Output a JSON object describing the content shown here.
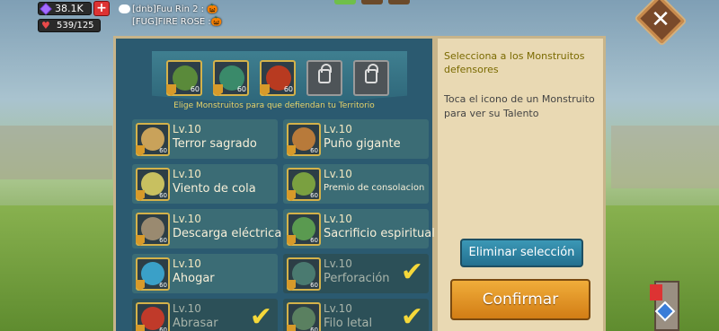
{
  "hud": {
    "gems": "38.1K",
    "plus": "+",
    "health": "539/125"
  },
  "chat": {
    "line1": "[dnb]Fuu Rin 2 :",
    "line2": "[FUG]FIRE  ROSE :"
  },
  "close_label": "✕",
  "defense_slots": [
    {
      "state": "filled",
      "level": "60"
    },
    {
      "state": "filled",
      "level": "60"
    },
    {
      "state": "filled",
      "level": "60"
    },
    {
      "state": "locked"
    },
    {
      "state": "locked"
    }
  ],
  "subtitle": "Elige Monstruitos para que defiendan tu Territorio",
  "familiars": [
    {
      "level": "Lv.10",
      "name": "Terror sagrado",
      "badge_level": "60",
      "selected": false,
      "color": "#c9a25a"
    },
    {
      "level": "Lv.10",
      "name": "Puño gigante",
      "badge_level": "60",
      "selected": false,
      "color": "#b87a3a"
    },
    {
      "level": "Lv.10",
      "name": "Viento de cola",
      "badge_level": "60",
      "selected": false,
      "color": "#c8c060"
    },
    {
      "level": "Lv.10",
      "name": "Premio de consolacion",
      "badge_level": "60",
      "selected": false,
      "color": "#7aa040",
      "small": true
    },
    {
      "level": "Lv.10",
      "name": "Descarga eléctrica",
      "badge_level": "60",
      "selected": false,
      "color": "#9a8a70"
    },
    {
      "level": "Lv.10",
      "name": "Sacrificio espiritual",
      "badge_level": "60",
      "selected": false,
      "color": "#5a9a50"
    },
    {
      "level": "Lv.10",
      "name": "Ahogar",
      "badge_level": "60",
      "selected": false,
      "color": "#3aa0c8"
    },
    {
      "level": "Lv.10",
      "name": "Perforación",
      "badge_level": "60",
      "selected": true,
      "color": "#4a7a70"
    },
    {
      "level": "Lv.10",
      "name": "Abrasar",
      "badge_level": "60",
      "selected": true,
      "color": "#c03a2a"
    },
    {
      "level": "Lv.10",
      "name": "Filo letal",
      "badge_level": "60",
      "selected": true,
      "color": "#5a8060"
    }
  ],
  "side": {
    "title": "Selecciona a los Monstruitos defensores",
    "description": "Toca el icono de un Monstruito para ver su Talento",
    "clear_button": "Eliminar selección",
    "confirm_button": "Confirmar"
  },
  "colors": {
    "panel": "#2b5a70",
    "accent_gold": "#d4b24a",
    "confirm": "#e0951f",
    "clear": "#2f86a5"
  }
}
